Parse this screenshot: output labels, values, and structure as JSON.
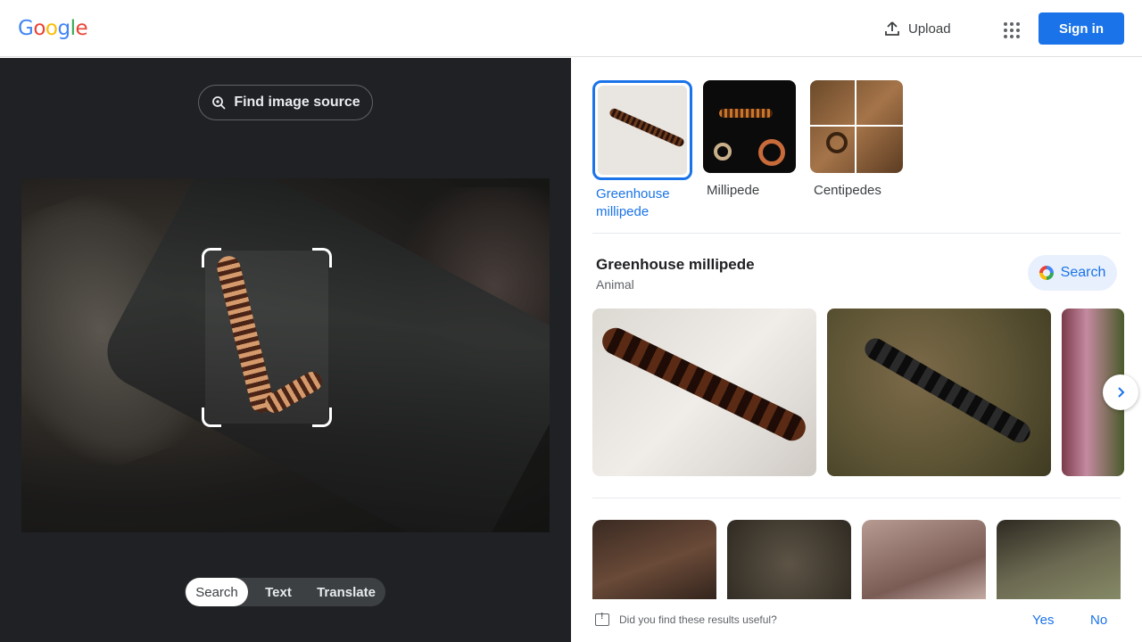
{
  "header": {
    "logo": {
      "letters": [
        "G",
        "o",
        "o",
        "g",
        "l",
        "e"
      ]
    },
    "upload_label": "Upload",
    "signin_label": "Sign in",
    "colors": {
      "accent": "#1a73e8"
    }
  },
  "left_pane": {
    "find_source_label": "Find image source",
    "tabs": [
      {
        "label": "Search",
        "active": true
      },
      {
        "label": "Text",
        "active": false
      },
      {
        "label": "Translate",
        "active": false
      }
    ]
  },
  "right_pane": {
    "chips": [
      {
        "label_line1": "Greenhouse",
        "label_line2": "millipede",
        "selected": true
      },
      {
        "label_line1": "Millipede",
        "label_line2": "",
        "selected": false
      },
      {
        "label_line1": "Centipedes",
        "label_line2": "",
        "selected": false
      }
    ],
    "entity": {
      "title": "Greenhouse millipede",
      "subtitle": "Animal"
    },
    "search_label": "Search",
    "next_icon": "chevron-right-icon"
  },
  "feedback": {
    "question": "Did you find these results useful?",
    "yes_label": "Yes",
    "no_label": "No"
  }
}
